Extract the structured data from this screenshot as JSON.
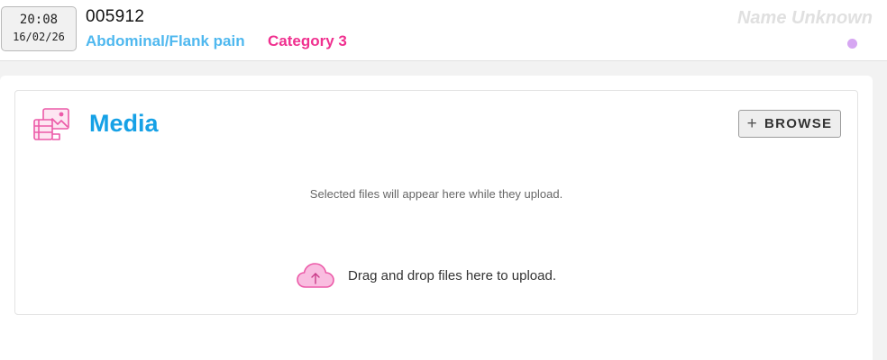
{
  "header": {
    "time": "20:08",
    "date": "16/02/26",
    "incident_id": "005912",
    "complaint": "Abdominal/Flank pain",
    "category": "Category 3",
    "patient_name": "Name Unknown",
    "status_dot_color": "#d6a6f2"
  },
  "media": {
    "title": "Media",
    "browse_label": "BROWSE",
    "browse_icon": "plus-icon",
    "title_icon": "media-gallery-icon",
    "upload_hint": "Selected files will appear here while they upload.",
    "drop_text": "Drag and drop files here to upload.",
    "drop_icon": "cloud-upload-icon"
  },
  "colors": {
    "complaint": "#4fb8ef",
    "category": "#f0308f",
    "media_title": "#16a1e6",
    "icon_pink": "#ec5aa8"
  }
}
